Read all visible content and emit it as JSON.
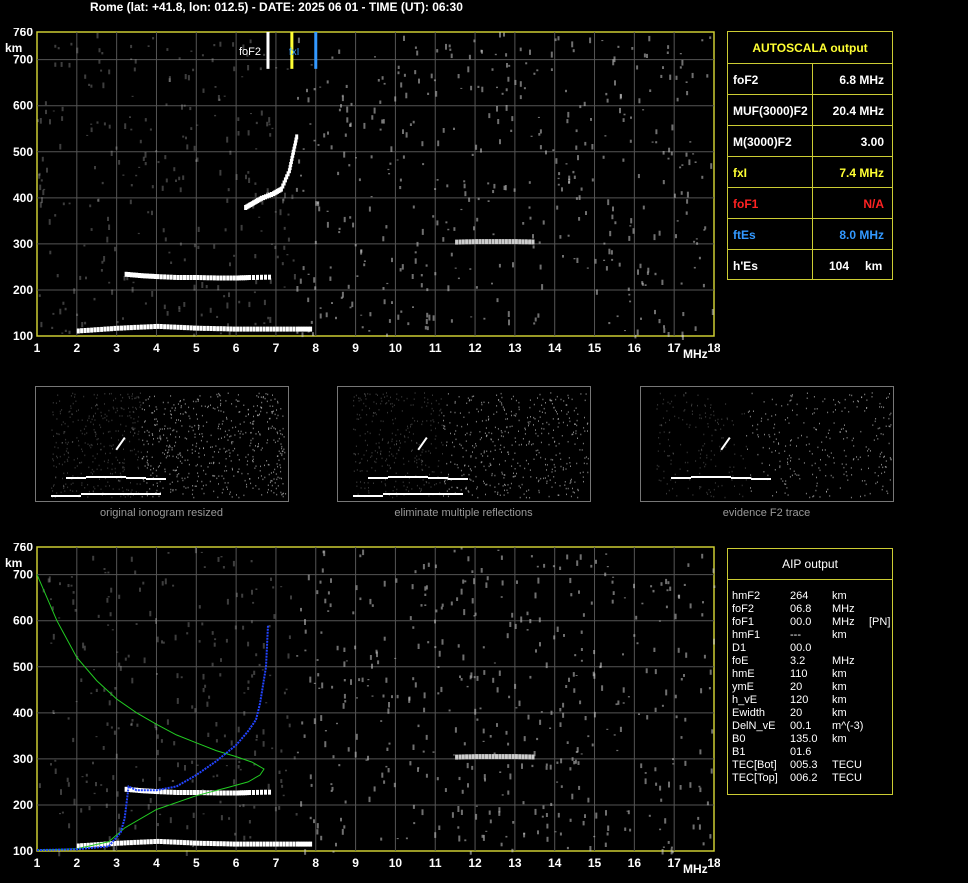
{
  "header": "Rome (lat: +41.8, lon: 012.5) - DATE: 2025 06 01 - TIME (UT): 06:30",
  "autoscala": {
    "title": "AUTOSCALA output",
    "rows": [
      {
        "label": "foF2",
        "value": "6.8 MHz",
        "color": "#ffffff"
      },
      {
        "label": "MUF(3000)F2",
        "value": "20.4 MHz",
        "color": "#ffffff"
      },
      {
        "label": "M(3000)F2",
        "value": "3.00",
        "color": "#ffffff"
      },
      {
        "label": "fxI",
        "value": "7.4 MHz",
        "color": "#ffff33"
      },
      {
        "label": "foF1",
        "value": "N/A",
        "color": "#ff2222"
      },
      {
        "label": "ftEs",
        "value": "8.0 MHz",
        "color": "#3399ff"
      },
      {
        "label": "h'Es",
        "value": "104",
        "unit": "km",
        "color": "#ffffff"
      }
    ]
  },
  "aip": {
    "title": "AIP output",
    "rows": [
      [
        "hmF2",
        "264",
        "km",
        ""
      ],
      [
        "foF2",
        "06.8",
        "MHz",
        ""
      ],
      [
        "foF1",
        "00.0",
        "MHz",
        "[PN]"
      ],
      [
        "hmF1",
        "---",
        "km",
        ""
      ],
      [
        "D1",
        "00.0",
        "",
        ""
      ],
      [
        "foE",
        "3.2",
        "MHz",
        ""
      ],
      [
        "hmE",
        "110",
        "km",
        ""
      ],
      [
        "ymE",
        "20",
        "km",
        ""
      ],
      [
        "h_vE",
        "120",
        "km",
        ""
      ],
      [
        "Ewidth",
        "20",
        "km",
        ""
      ],
      [
        "DelN_vE",
        "00.1",
        "m^(-3)",
        ""
      ],
      [
        "B0",
        "135.0",
        "km",
        ""
      ],
      [
        "B1",
        "01.6",
        "",
        ""
      ],
      [
        "TEC[Bot]",
        "005.3",
        "TECU",
        ""
      ],
      [
        "TEC[Top]",
        "006.2",
        "TECU",
        ""
      ]
    ]
  },
  "captions": [
    "original ionogram resized",
    "eliminate multiple reflections",
    "evidence F2 trace"
  ],
  "marker_labels": {
    "foF2": "foF2",
    "fxI": "fxI"
  },
  "chart_data": [
    {
      "type": "scatter",
      "title": "",
      "xlabel": "MHz",
      "ylabel": "km",
      "xlim": [
        1,
        18
      ],
      "ylim": [
        100,
        760
      ],
      "xticks": [
        1,
        2,
        3,
        4,
        5,
        6,
        7,
        8,
        9,
        10,
        11,
        12,
        13,
        14,
        15,
        16,
        17,
        18
      ],
      "yticks": [
        100,
        200,
        300,
        400,
        500,
        600,
        700,
        760
      ],
      "grid": true,
      "markers": [
        {
          "name": "foF2",
          "x": 6.8,
          "color": "#ffffff"
        },
        {
          "name": "fxI",
          "x": 7.4,
          "color": "#ffff33"
        },
        {
          "name": "ftEs",
          "x": 8.0,
          "color": "#3399ff"
        }
      ],
      "traces": [
        {
          "name": "Es",
          "color": "#ffffff",
          "points": [
            [
              2.0,
              112
            ],
            [
              2.5,
              115
            ],
            [
              3.0,
              118
            ],
            [
              3.5,
              120
            ],
            [
              4.0,
              122
            ],
            [
              4.5,
              120
            ],
            [
              5.0,
              118
            ],
            [
              5.5,
              117
            ],
            [
              6.0,
              116
            ],
            [
              6.5,
              116
            ],
            [
              7.0,
              116
            ],
            [
              7.5,
              116
            ],
            [
              7.9,
              116
            ]
          ]
        },
        {
          "name": "F2 o-trace",
          "color": "#ffffff",
          "points": [
            [
              3.2,
              235
            ],
            [
              3.6,
              232
            ],
            [
              4.0,
              230
            ],
            [
              4.5,
              228
            ],
            [
              5.0,
              228
            ],
            [
              5.5,
              227
            ],
            [
              6.0,
              227
            ],
            [
              6.3,
              228
            ],
            [
              6.9,
              229
            ]
          ]
        },
        {
          "name": "F2 upper",
          "color": "#ffffff",
          "points": [
            [
              6.2,
              380
            ],
            [
              6.4,
              390
            ],
            [
              6.6,
              400
            ],
            [
              6.9,
              410
            ],
            [
              7.1,
              420
            ],
            [
              7.3,
              460
            ],
            [
              7.4,
              500
            ],
            [
              7.5,
              540
            ]
          ]
        },
        {
          "name": "Es multiple",
          "color": "#cccccc",
          "points": [
            [
              11.5,
              305
            ],
            [
              12.0,
              306
            ],
            [
              12.5,
              306
            ],
            [
              13.0,
              306
            ],
            [
              13.5,
              305
            ]
          ]
        }
      ]
    },
    {
      "type": "scatter",
      "title": "",
      "xlabel": "MHz",
      "ylabel": "km",
      "xlim": [
        1,
        18
      ],
      "ylim": [
        100,
        760
      ],
      "xticks": [
        1,
        2,
        3,
        4,
        5,
        6,
        7,
        8,
        9,
        10,
        11,
        12,
        13,
        14,
        15,
        16,
        17,
        18
      ],
      "yticks": [
        100,
        200,
        300,
        400,
        500,
        600,
        700,
        760
      ],
      "grid": true,
      "traces": [
        {
          "name": "Es",
          "color": "#ffffff",
          "points": [
            [
              2.0,
              112
            ],
            [
              2.5,
              115
            ],
            [
              3.0,
              118
            ],
            [
              3.5,
              120
            ],
            [
              4.0,
              122
            ],
            [
              4.5,
              120
            ],
            [
              5.0,
              118
            ],
            [
              5.5,
              117
            ],
            [
              6.0,
              116
            ],
            [
              6.5,
              116
            ],
            [
              7.0,
              116
            ],
            [
              7.5,
              116
            ],
            [
              7.9,
              116
            ]
          ]
        },
        {
          "name": "F2 o-trace",
          "color": "#ffffff",
          "points": [
            [
              3.2,
              235
            ],
            [
              3.6,
              232
            ],
            [
              4.0,
              230
            ],
            [
              4.5,
              228
            ],
            [
              5.0,
              228
            ],
            [
              5.5,
              227
            ],
            [
              6.0,
              227
            ],
            [
              6.3,
              228
            ],
            [
              6.9,
              229
            ]
          ]
        },
        {
          "name": "Es multiple",
          "color": "#cccccc",
          "points": [
            [
              11.5,
              305
            ],
            [
              12.0,
              306
            ],
            [
              12.5,
              306
            ],
            [
              13.0,
              306
            ],
            [
              13.5,
              305
            ]
          ]
        }
      ],
      "curves": [
        {
          "name": "profile",
          "color": "#22cc22",
          "points": [
            [
              1.0,
              700
            ],
            [
              1.5,
              600
            ],
            [
              2.0,
              520
            ],
            [
              2.5,
              470
            ],
            [
              3.0,
              430
            ],
            [
              3.5,
              400
            ],
            [
              4.0,
              375
            ],
            [
              4.5,
              352
            ],
            [
              5.0,
              335
            ],
            [
              5.5,
              318
            ],
            [
              6.0,
              305
            ],
            [
              6.4,
              293
            ],
            [
              6.7,
              278
            ],
            [
              6.6,
              265
            ],
            [
              6.3,
              250
            ],
            [
              5.8,
              238
            ],
            [
              5.0,
              220
            ],
            [
              4.0,
              190
            ],
            [
              3.2,
              150
            ],
            [
              2.8,
              120
            ],
            [
              2.0,
              105
            ],
            [
              1.0,
              102
            ]
          ]
        },
        {
          "name": "virtual height",
          "color": "#2244ff",
          "points": [
            [
              1.0,
              102
            ],
            [
              2.0,
              104
            ],
            [
              2.8,
              110
            ],
            [
              3.1,
              140
            ],
            [
              3.2,
              170
            ],
            [
              3.3,
              240
            ],
            [
              3.5,
              232
            ],
            [
              4.0,
              232
            ],
            [
              4.5,
              240
            ],
            [
              5.0,
              265
            ],
            [
              5.5,
              295
            ],
            [
              6.0,
              330
            ],
            [
              6.3,
              360
            ],
            [
              6.5,
              385
            ],
            [
              6.6,
              420
            ],
            [
              6.75,
              500
            ],
            [
              6.8,
              590
            ]
          ]
        }
      ]
    }
  ]
}
